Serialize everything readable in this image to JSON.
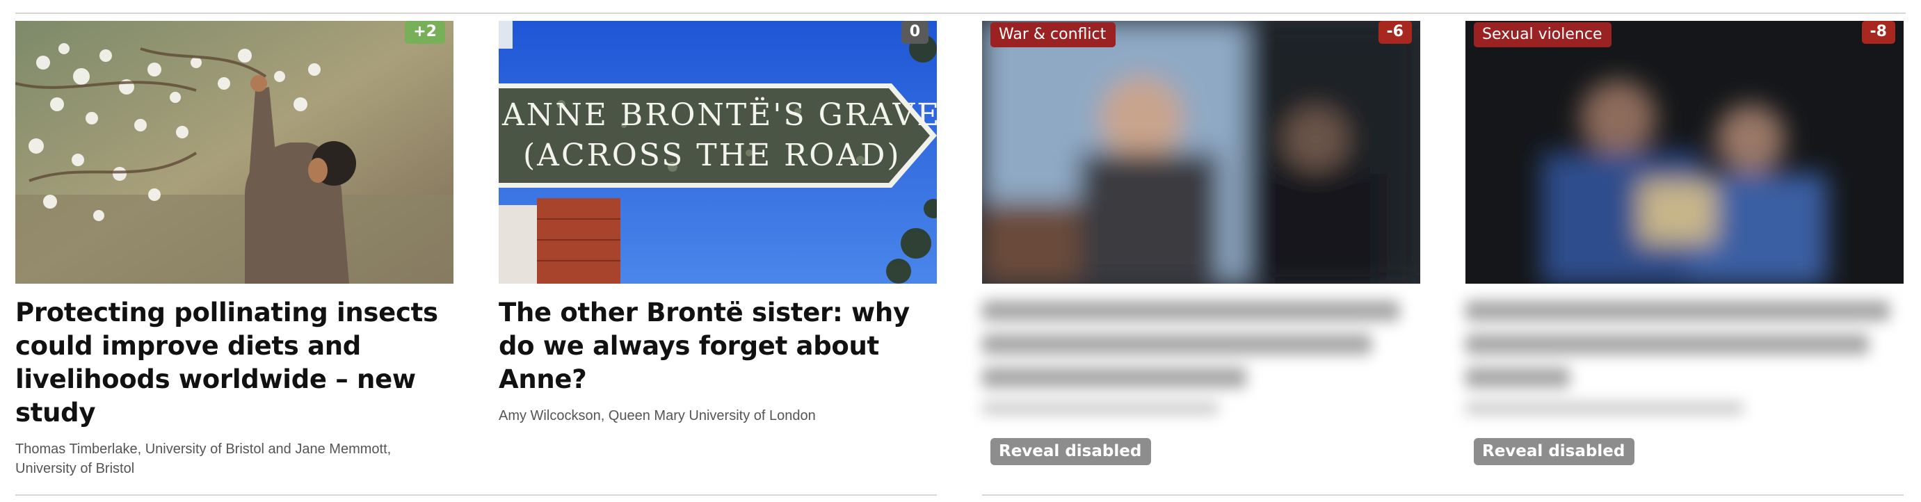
{
  "cards": [
    {
      "score": "+2",
      "title": "Protecting pollinating insects could improve diets and livelihoods worldwide – new study",
      "author": "Thomas Timberlake, University of Bristol and Jane Memmott, University of Bristol",
      "image": "man-picking-blossoms"
    },
    {
      "score": "0",
      "title": "The other Brontë sister: why do we always forget about Anne?",
      "author": "Amy Wilcockson, Queen Mary University of London",
      "image": "sign",
      "sign_line1": "ANNE BRONTË'S GRAVE",
      "sign_line2": "(ACROSS THE ROAD)"
    },
    {
      "score": "-6",
      "tag": "War & conflict",
      "reveal_label": "Reveal disabled",
      "image": "blurred-photo"
    },
    {
      "score": "-8",
      "tag": "Sexual violence",
      "reveal_label": "Reveal disabled",
      "image": "blurred-photo"
    }
  ],
  "colors": {
    "positive": "#78b05a",
    "neutral": "#5a5a5a",
    "negative": "#a8281f",
    "tag": "#9b2222",
    "reveal": "#8d8d8d"
  }
}
